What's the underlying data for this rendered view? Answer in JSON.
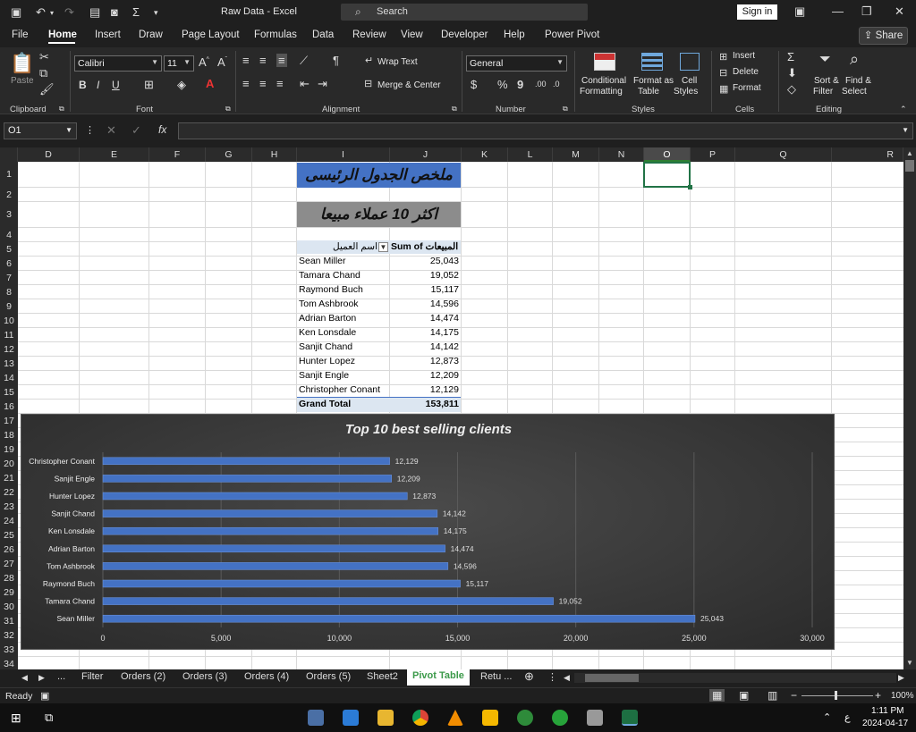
{
  "window": {
    "title": "Raw Data  -  Excel",
    "search_placeholder": "Search",
    "sign_in": "Sign in"
  },
  "menu": {
    "tabs": [
      "File",
      "Home",
      "Insert",
      "Draw",
      "Page Layout",
      "Formulas",
      "Data",
      "Review",
      "View",
      "Developer",
      "Help",
      "Power Pivot"
    ],
    "active": "Home",
    "share": "Share"
  },
  "ribbon": {
    "clipboard": {
      "paste": "Paste",
      "label": "Clipboard"
    },
    "font": {
      "name": "Calibri",
      "size": "11",
      "bold": "B",
      "italic": "I",
      "underline": "U",
      "label": "Font"
    },
    "alignment": {
      "wrap": "Wrap Text",
      "merge": "Merge & Center",
      "label": "Alignment"
    },
    "number": {
      "format": "General",
      "currency": "$",
      "percent": "%",
      "comma": "9",
      "label": "Number"
    },
    "styles": {
      "conditional1": "Conditional",
      "conditional2": "Formatting",
      "format_table1": "Format as",
      "format_table2": "Table",
      "cell_styles1": "Cell",
      "cell_styles2": "Styles",
      "label": "Styles"
    },
    "cells": {
      "insert": "Insert",
      "delete": "Delete",
      "format": "Format",
      "label": "Cells"
    },
    "editing": {
      "sigma": "Σ",
      "sort1": "Sort &",
      "sort2": "Filter",
      "find1": "Find &",
      "find2": "Select",
      "label": "Editing"
    }
  },
  "formula_bar": {
    "name_box": "O1",
    "fx": "fx",
    "value": ""
  },
  "columns": [
    "D",
    "E",
    "F",
    "G",
    "H",
    "I",
    "J",
    "K",
    "L",
    "M",
    "N",
    "O",
    "P",
    "Q",
    "R"
  ],
  "rows": [
    "1",
    "2",
    "3",
    "4",
    "5",
    "6",
    "7",
    "8",
    "9",
    "10",
    "11",
    "12",
    "13",
    "14",
    "15",
    "16",
    "17",
    "18",
    "19",
    "20",
    "21",
    "22",
    "23",
    "24",
    "25",
    "26",
    "27",
    "28",
    "29",
    "30",
    "31",
    "32",
    "33",
    "34"
  ],
  "sheet": {
    "title_main": "ملخص الجدول الرئيسى",
    "title_sub": "اكثر 10 عملاء مبيعا",
    "pivot_header_client": "اسم العميل",
    "pivot_header_sum": "Sum of المبيعات",
    "pivot_rows": [
      {
        "name": "Sean Miller",
        "value": "25,043"
      },
      {
        "name": "Tamara Chand",
        "value": "19,052"
      },
      {
        "name": "Raymond Buch",
        "value": "15,117"
      },
      {
        "name": "Tom Ashbrook",
        "value": "14,596"
      },
      {
        "name": "Adrian Barton",
        "value": "14,474"
      },
      {
        "name": "Ken Lonsdale",
        "value": "14,175"
      },
      {
        "name": "Sanjit Chand",
        "value": "14,142"
      },
      {
        "name": "Hunter Lopez",
        "value": "12,873"
      },
      {
        "name": "Sanjit Engle",
        "value": "12,209"
      },
      {
        "name": "Christopher Conant",
        "value": "12,129"
      }
    ],
    "grand_total_label": "Grand Total",
    "grand_total_value": "153,811"
  },
  "chart_data": {
    "type": "bar",
    "title": "Top 10 best selling clients",
    "categories": [
      "Christopher Conant",
      "Sanjit Engle",
      "Hunter Lopez",
      "Sanjit Chand",
      "Ken Lonsdale",
      "Adrian Barton",
      "Tom Ashbrook",
      "Raymond Buch",
      "Tamara Chand",
      "Sean Miller"
    ],
    "values": [
      12129,
      12209,
      12873,
      14142,
      14175,
      14474,
      14596,
      15117,
      19052,
      25043
    ],
    "data_labels": [
      "12,129",
      "12,209",
      "12,873",
      "14,142",
      "14,175",
      "14,474",
      "14,596",
      "15,117",
      "19,052",
      "25,043"
    ],
    "xlim": [
      0,
      30000
    ],
    "xticks": [
      "0",
      "5,000",
      "10,000",
      "15,000",
      "20,000",
      "25,000",
      "30,000"
    ],
    "orientation": "horizontal",
    "bar_color": "#4472c4",
    "grid": true
  },
  "sheet_tabs": {
    "nav_more": "...",
    "tabs": [
      "Filter",
      "Orders (2)",
      "Orders (3)",
      "Orders (4)",
      "Orders (5)",
      "Sheet2",
      "Pivot Table",
      "Retu ..."
    ],
    "active": "Pivot Table"
  },
  "status": {
    "ready": "Ready",
    "zoom": "100%"
  },
  "taskbar": {
    "time": "1:11 PM",
    "date": "2024-04-17",
    "lang": "ع"
  }
}
